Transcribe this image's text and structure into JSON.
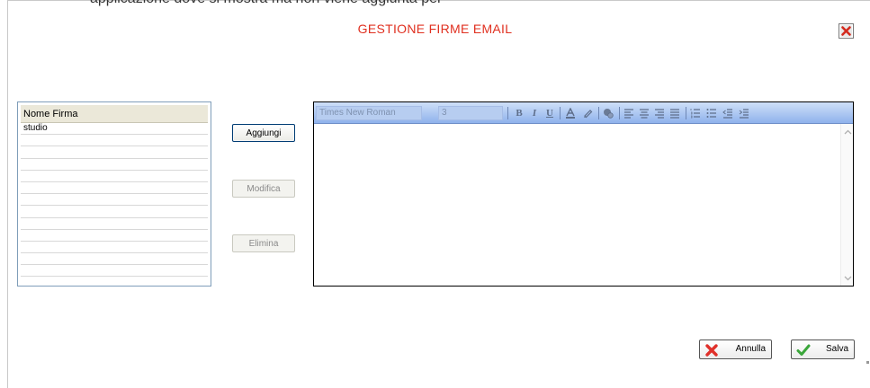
{
  "header": {
    "top_text": "applicazione dove si mostra ma non viene aggiunta per"
  },
  "dialog": {
    "title": "GESTIONE FIRME EMAIL",
    "close_icon": "close-x-icon"
  },
  "signature_list": {
    "column_header": "Nome Firma",
    "rows": [
      "studio",
      "",
      "",
      "",
      "",
      "",
      "",
      "",
      "",
      "",
      "",
      "",
      ""
    ]
  },
  "actions": {
    "add_label": "Aggiungi",
    "edit_label": "Modifica",
    "delete_label": "Elimina"
  },
  "editor": {
    "font_name": "Times New Roman",
    "font_size": "3",
    "toolbar_icons": [
      "bold-icon",
      "italic-icon",
      "underline-icon",
      "font-color-icon",
      "highlight-icon",
      "link-icon",
      "align-left-icon",
      "align-center-icon",
      "align-right-icon",
      "justify-icon",
      "ordered-list-icon",
      "unordered-list-icon",
      "outdent-icon",
      "indent-icon"
    ],
    "content": ""
  },
  "footer": {
    "cancel_label": "Annulla",
    "save_label": "Salva",
    "colors": {
      "cancel_icon": "#e0302a",
      "save_icon": "#3aa63a"
    }
  },
  "colors": {
    "title": "#e03020",
    "toolbar_top": "#cfe0f8",
    "toolbar_bottom": "#8fb2ec",
    "list_border": "#7f9db9"
  }
}
